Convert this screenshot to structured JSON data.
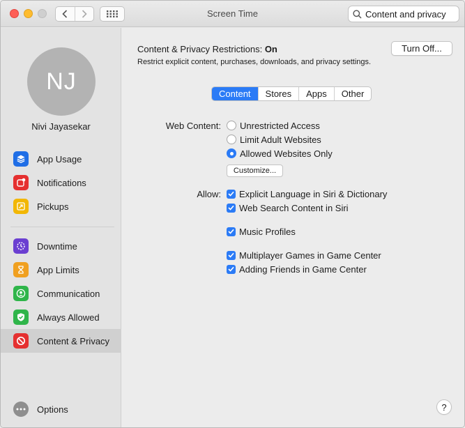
{
  "window": {
    "title": "Screen Time"
  },
  "search": {
    "value": "Content and privacy"
  },
  "user": {
    "initials": "NJ",
    "name": "Nivi Jayasekar"
  },
  "sidebar": {
    "items": [
      {
        "label": "App Usage",
        "icon": "layers-icon"
      },
      {
        "label": "Notifications",
        "icon": "bell-badge-icon"
      },
      {
        "label": "Pickups",
        "icon": "pickup-arrow-icon"
      },
      {
        "label": "Downtime",
        "icon": "moon-clock-icon"
      },
      {
        "label": "App Limits",
        "icon": "hourglass-icon"
      },
      {
        "label": "Communication",
        "icon": "person-circle-icon"
      },
      {
        "label": "Always Allowed",
        "icon": "checkmark-shield-icon"
      },
      {
        "label": "Content & Privacy",
        "icon": "restricted-icon",
        "selected": true
      }
    ],
    "options_label": "Options"
  },
  "main": {
    "restrictions_label": "Content & Privacy Restrictions:",
    "restrictions_status": "On",
    "description": "Restrict explicit content, purchases, downloads, and privacy settings.",
    "turn_off_label": "Turn Off...",
    "tabs": [
      {
        "label": "Content",
        "active": true
      },
      {
        "label": "Stores",
        "active": false
      },
      {
        "label": "Apps",
        "active": false
      },
      {
        "label": "Other",
        "active": false
      }
    ],
    "web_content_label": "Web Content:",
    "web_options": [
      {
        "label": "Unrestricted Access",
        "selected": false
      },
      {
        "label": "Limit Adult Websites",
        "selected": false
      },
      {
        "label": "Allowed Websites Only",
        "selected": true
      }
    ],
    "customize_label": "Customize...",
    "allow_label": "Allow:",
    "allow_options": [
      {
        "label": "Explicit Language in Siri & Dictionary",
        "checked": true
      },
      {
        "label": "Web Search Content in Siri",
        "checked": true
      },
      {
        "label": "Music Profiles",
        "checked": true
      },
      {
        "label": "Multiplayer Games in Game Center",
        "checked": true
      },
      {
        "label": "Adding Friends in Game Center",
        "checked": true
      }
    ],
    "help_label": "?"
  },
  "colors": {
    "accent": "#2b7bf6",
    "selected_row": "#d0d0d0"
  }
}
